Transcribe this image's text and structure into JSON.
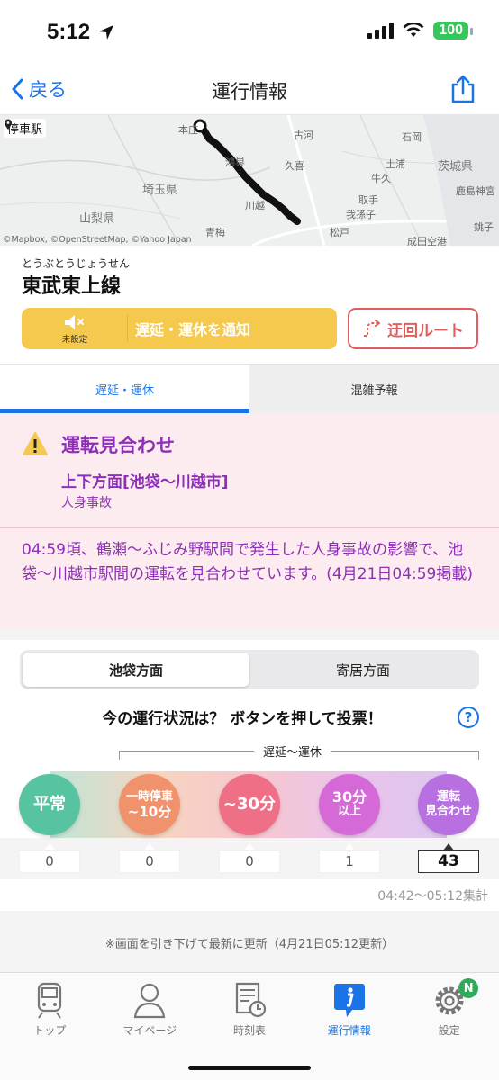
{
  "status_bar": {
    "time": "5:12",
    "battery": "100"
  },
  "nav": {
    "back_label": "戻る",
    "title": "運行情報"
  },
  "map": {
    "badge": "停車駅",
    "labels": [
      "本庄",
      "古河",
      "石岡",
      "土浦",
      "茨城県",
      "埼玉県",
      "牛久",
      "鹿島神宮",
      "山梨県",
      "川越",
      "我孫子",
      "青梅",
      "松戸",
      "成田空港",
      "銚子",
      "鴻巣",
      "久喜",
      "取手"
    ],
    "credit": "©Mapbox, ©OpenStreetMap, ©Yahoo Japan"
  },
  "line": {
    "furigana": "とうぶとうじょうせん",
    "name": "東武東上線"
  },
  "actions": {
    "notify_unset": "未設定",
    "notify_label": "遅延・運休を通知",
    "detour_label": "迂回ルート"
  },
  "tabs": {
    "delay": "遅延・運休",
    "crowd": "混雑予報"
  },
  "alert": {
    "status": "運転見合わせ",
    "direction": "上下方面[池袋〜川越市]",
    "cause": "人身事故",
    "description": "04:59頃、鶴瀬〜ふじみ野駅間で発生した人身事故の影響で、池袋〜川越市駅間の運転を見合わせています。(4月21日04:59掲載)"
  },
  "segment": {
    "left": "池袋方面",
    "right": "寄居方面"
  },
  "vote": {
    "title": "今の運行状況は？ ボタンを押して投票！",
    "help": "?",
    "bracket_label": "遅延〜運休",
    "options": [
      {
        "line1": "平常",
        "line2": "",
        "count": "0",
        "color": "#58c3a0"
      },
      {
        "line1": "一時停車",
        "line2": "~10分",
        "count": "0",
        "color": "#f0936d"
      },
      {
        "line1": "~30分",
        "line2": "",
        "count": "0",
        "color": "#ee6f86"
      },
      {
        "line1": "30分",
        "line2": "以上",
        "count": "1",
        "color": "#d669d8"
      },
      {
        "line1": "運転",
        "line2": "見合わせ",
        "count": "43",
        "color": "#b86fdf"
      }
    ],
    "tally_period": "04:42〜05:12集計"
  },
  "refresh_note": "※画面を引き下げて最新に更新（4月21日05:12更新）",
  "tabbar": {
    "items": [
      {
        "label": "トップ"
      },
      {
        "label": "マイページ"
      },
      {
        "label": "時刻表"
      },
      {
        "label": "運行情報"
      },
      {
        "label": "設定",
        "badge": "N"
      }
    ]
  },
  "colors": {
    "accent": "#1a74e8",
    "alert_text": "#8e2fb8",
    "alert_bg": "#fcecef",
    "notify_bg": "#f5c94d",
    "detour": "#e25c5c"
  }
}
